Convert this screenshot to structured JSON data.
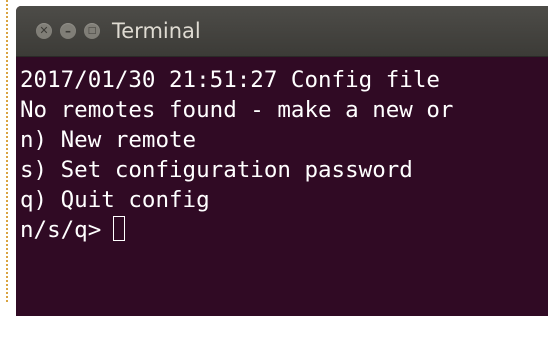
{
  "window": {
    "title": "Terminal",
    "buttons": {
      "close_icon": "close-icon",
      "minimize_icon": "minimize-icon",
      "maximize_icon": "maximize-icon"
    },
    "colors": {
      "background": "#300a24",
      "titlebar": "#3c3b37",
      "text": "#ffffff"
    }
  },
  "terminal": {
    "lines": [
      "2017/01/30 21:51:27 Config file",
      "No remotes found - make a new or",
      "n) New remote",
      "s) Set configuration password",
      "q) Quit config"
    ],
    "prompt": "n/s/q>"
  }
}
